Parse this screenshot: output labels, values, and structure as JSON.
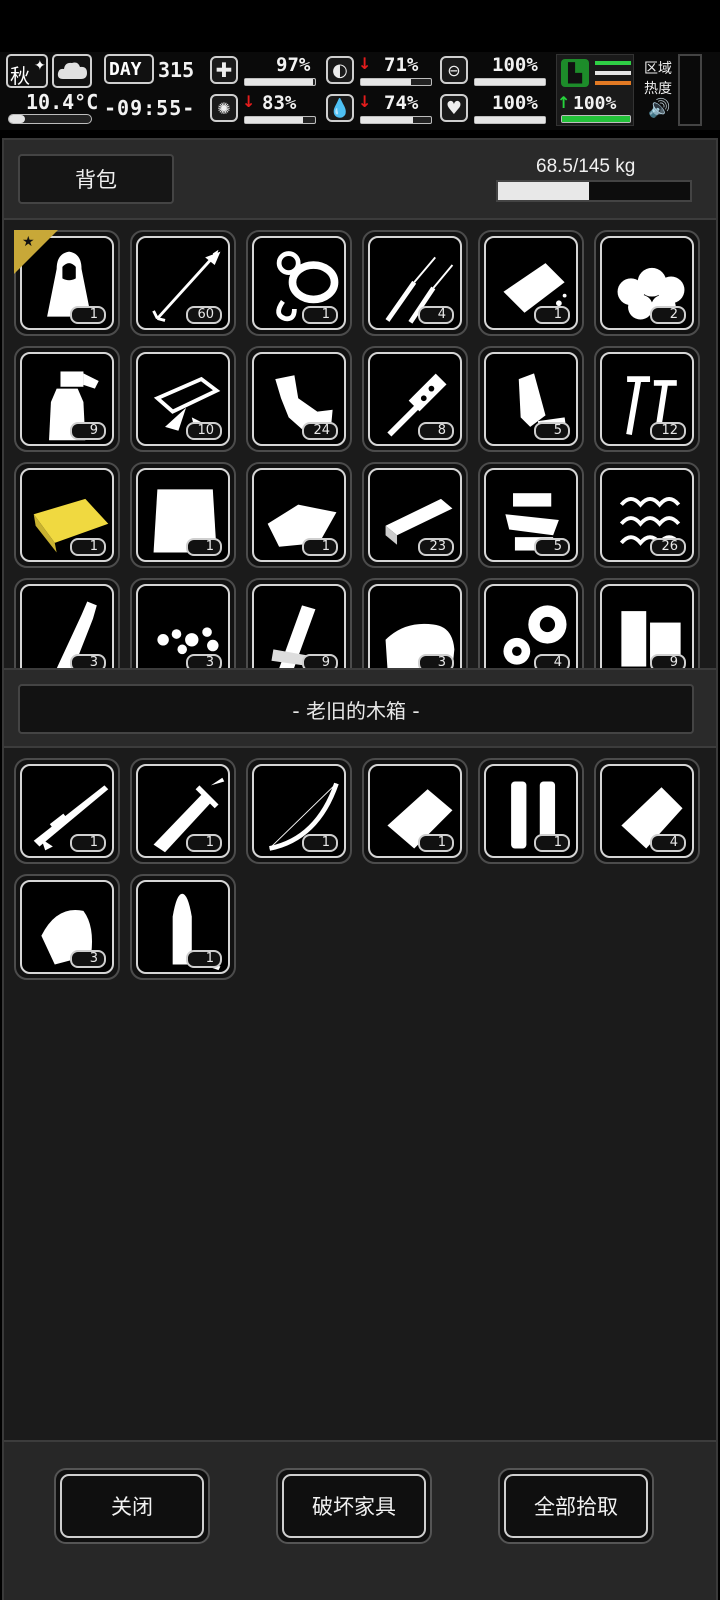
{
  "hud": {
    "season": "秋",
    "temperature": "10.4°C",
    "day_label": "DAY",
    "day_value": "315",
    "time": "-09:55-",
    "stats": {
      "health": "97%",
      "stomach": "71%",
      "warmth": "100%",
      "disease": "83%",
      "water": "74%",
      "heart": "100%",
      "stamina": "100%"
    },
    "bars": {
      "health": 0.97,
      "stomach": 0.71,
      "warmth": 1.0,
      "disease": 0.83,
      "water": 0.74,
      "heart": 1.0,
      "stamina": 1.0
    },
    "zone_label_1": "区域",
    "zone_label_2": "热度"
  },
  "backpack": {
    "tab_label": "背包",
    "weight_text": "68.5/145 kg",
    "weight_fraction": 0.472,
    "items": [
      {
        "icon": "cloak-icon",
        "count": "1",
        "badge": true
      },
      {
        "icon": "arrow-icon",
        "count": "60"
      },
      {
        "icon": "rope-icon",
        "count": "1"
      },
      {
        "icon": "lockpick-icon",
        "count": "4"
      },
      {
        "icon": "cracker-icon",
        "count": "1"
      },
      {
        "icon": "cotton-icon",
        "count": "2"
      },
      {
        "icon": "spray-bottle-icon",
        "count": "9"
      },
      {
        "icon": "glass-shards-icon",
        "count": "10"
      },
      {
        "icon": "scrap-metal-icon",
        "count": "24"
      },
      {
        "icon": "file-tool-icon",
        "count": "8"
      },
      {
        "icon": "plastic-bottle-icon",
        "count": "5"
      },
      {
        "icon": "screws-icon",
        "count": "12"
      },
      {
        "icon": "yellow-cloth-icon",
        "count": "1"
      },
      {
        "icon": "cloth-icon",
        "count": "1"
      },
      {
        "icon": "rag-icon",
        "count": "1"
      },
      {
        "icon": "metal-bar-icon",
        "count": "23"
      },
      {
        "icon": "mechanical-parts-icon",
        "count": "5"
      },
      {
        "icon": "spring-icon",
        "count": "26"
      },
      {
        "icon": "bottle-icon",
        "count": "3"
      },
      {
        "icon": "rubble-icon",
        "count": "3"
      },
      {
        "icon": "planks-icon",
        "count": "9"
      },
      {
        "icon": "fabric-icon",
        "count": "3"
      },
      {
        "icon": "gears-icon",
        "count": "4"
      },
      {
        "icon": "wood-blocks-icon",
        "count": "9"
      }
    ]
  },
  "container": {
    "title": "- 老旧的木箱 -",
    "items": [
      {
        "icon": "sniper-rifle-icon",
        "count": "1"
      },
      {
        "icon": "sword-icon",
        "count": "1"
      },
      {
        "icon": "bow-icon",
        "count": "1"
      },
      {
        "icon": "food-packet-icon",
        "count": "1"
      },
      {
        "icon": "shells-icon",
        "count": "1"
      },
      {
        "icon": "bag-icon",
        "count": "4"
      },
      {
        "icon": "bullet-head-icon",
        "count": "3"
      },
      {
        "icon": "cartridge-icon",
        "count": "1"
      }
    ]
  },
  "footer": {
    "close_label": "关闭",
    "destroy_label": "破坏家具",
    "take_all_label": "全部拾取"
  }
}
